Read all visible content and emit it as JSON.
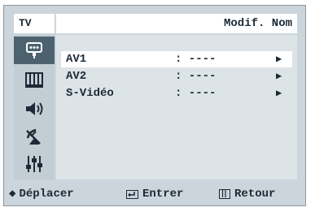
{
  "header": {
    "tv_label": "TV",
    "title": "Modif. Nom"
  },
  "sidebar": {
    "items": [
      {
        "icon": "input-icon",
        "active": true
      },
      {
        "icon": "picture-icon",
        "active": false
      },
      {
        "icon": "sound-icon",
        "active": false
      },
      {
        "icon": "channel-antenna-icon",
        "active": false
      },
      {
        "icon": "setup-icon",
        "active": false
      }
    ]
  },
  "menu": {
    "rows": [
      {
        "label": "AV1",
        "value": ": ----",
        "arrow": "▶"
      },
      {
        "label": "AV2",
        "value": ": ----",
        "arrow": "▶"
      },
      {
        "label": "S-Vidéo",
        "value": ": ----",
        "arrow": "▶"
      }
    ]
  },
  "footer": {
    "move_label": "Déplacer",
    "enter_label": "Entrer",
    "return_label": "Retour",
    "move_icon": "◆"
  }
}
